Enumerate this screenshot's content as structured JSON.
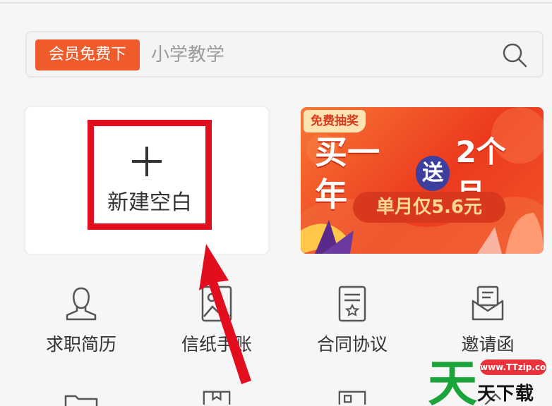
{
  "search": {
    "badge": "会员免费下",
    "placeholder": "小学教学",
    "icon": "search-icon"
  },
  "new_blank": {
    "label": "新建空白",
    "icon": "plus-icon",
    "highlight_color": "#e20d1d"
  },
  "promo": {
    "tag": "免费抽奖",
    "headline_part1": "买一年",
    "gift_char": "送",
    "headline_part2": "2个月",
    "price": "单月仅5.6元"
  },
  "shortcuts": [
    {
      "label": "求职简历",
      "icon": "resume-icon"
    },
    {
      "label": "信纸手账",
      "icon": "letter-paper-icon"
    },
    {
      "label": "合同协议",
      "icon": "contract-icon"
    },
    {
      "label": "邀请函",
      "icon": "invitation-icon"
    }
  ],
  "watermark": {
    "url": "www.TTzip.com",
    "name": "天下载",
    "logo_char": "天"
  },
  "colors": {
    "accent": "#f05b2c",
    "promo_blue": "#3c3f9e",
    "annotation_red": "#e20d1d"
  }
}
